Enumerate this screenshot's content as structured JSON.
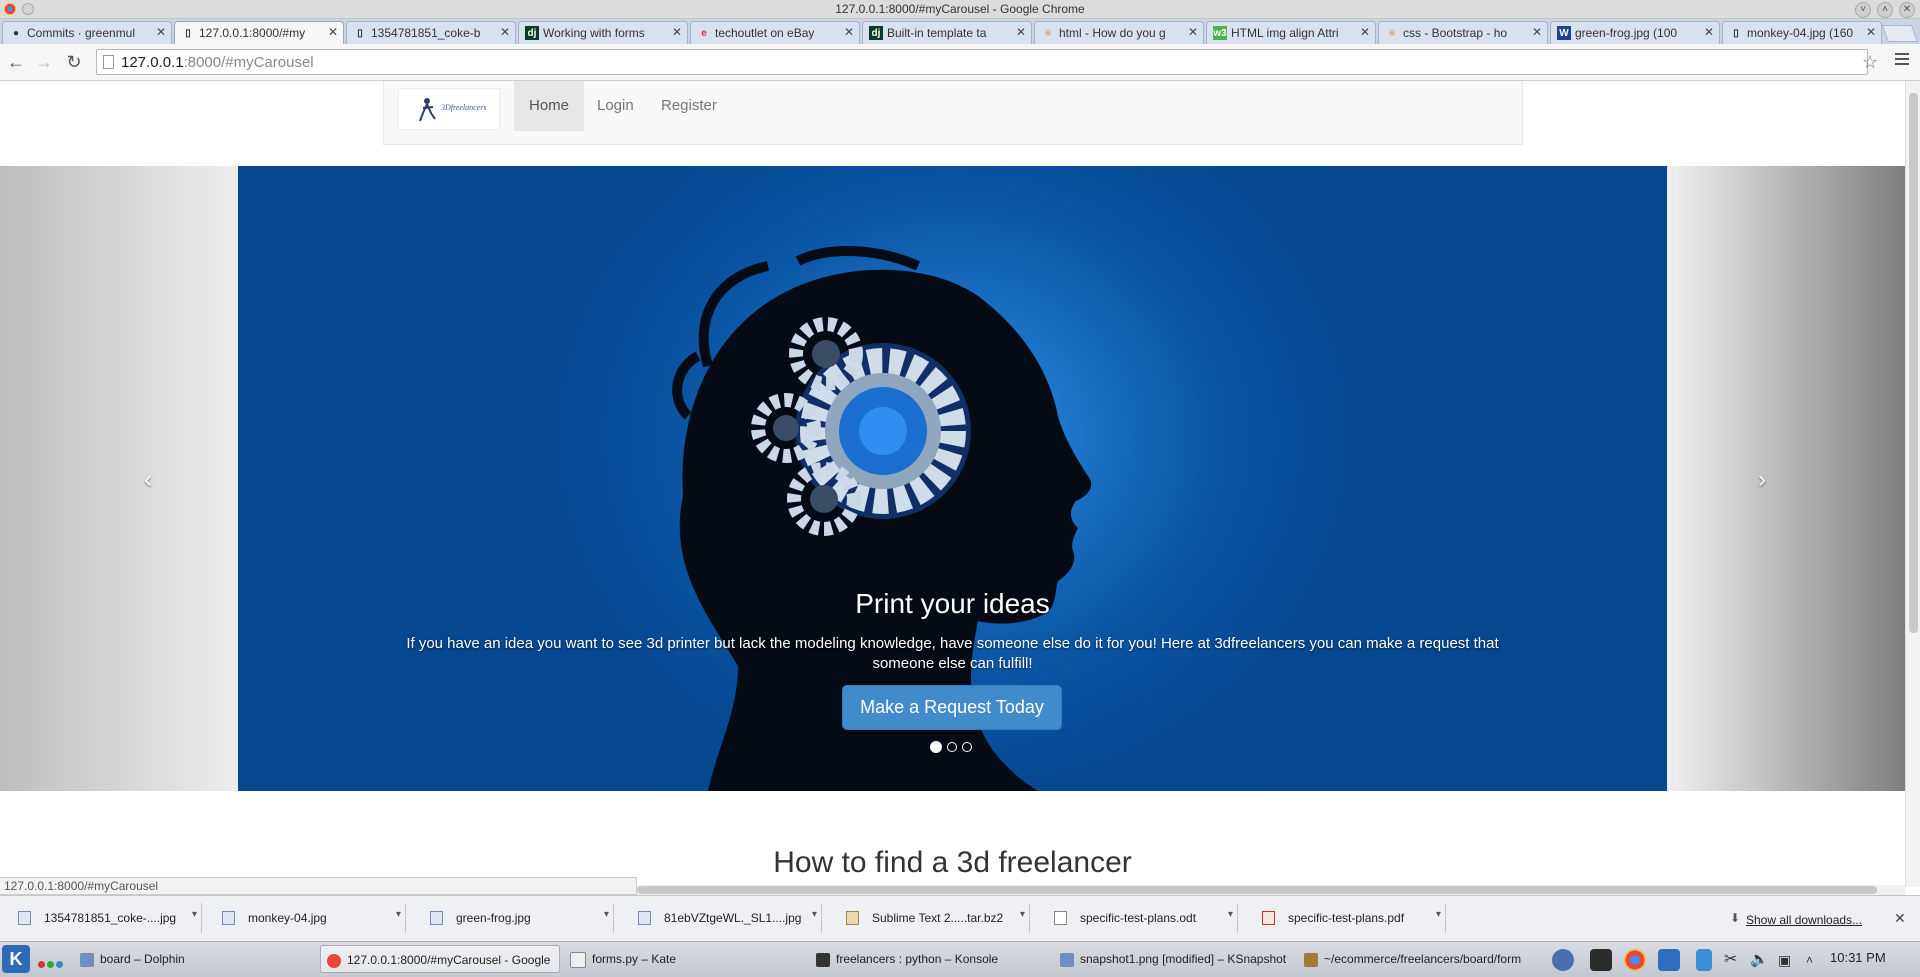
{
  "window": {
    "title": "127.0.0.1:8000/#myCarousel - Google Chrome"
  },
  "tabs": [
    {
      "label": "Commits · greenmul",
      "icon": "github-icon"
    },
    {
      "label": "127.0.0.1:8000/#my",
      "icon": "page-icon",
      "active": true
    },
    {
      "label": "1354781851_coke-b",
      "icon": "page-icon"
    },
    {
      "label": "Working with forms",
      "icon": "django-icon"
    },
    {
      "label": "techoutlet on eBay",
      "icon": "ebay-icon"
    },
    {
      "label": "Built-in template ta",
      "icon": "django-icon"
    },
    {
      "label": "html - How do you g",
      "icon": "stackoverflow-icon"
    },
    {
      "label": "HTML img align Attri",
      "icon": "w3schools-icon"
    },
    {
      "label": "css - Bootstrap - ho",
      "icon": "stackoverflow-icon"
    },
    {
      "label": "green-frog.jpg (100",
      "icon": "w-icon"
    },
    {
      "label": "monkey-04.jpg (160",
      "icon": "page-icon"
    }
  ],
  "toolbar": {
    "url_host": "127.0.0.1",
    "url_rest": ":8000/#myCarousel"
  },
  "site": {
    "brand": "3Dfreelancers",
    "nav": [
      "Home",
      "Login",
      "Register"
    ],
    "carousel": {
      "title": "Print your ideas",
      "text": "If you have an idea you want to see 3d printer but lack the modeling knowledge, have someone else do it for you! Here at 3dfreelancers you can make a request that someone else can fulfill!",
      "cta": "Make a Request Today",
      "prev": "‹",
      "next": "›",
      "active_slide": 1,
      "slide_count": 3
    },
    "section_heading": "How to find a 3d freelancer"
  },
  "status_url": "127.0.0.1:8000/#myCarousel",
  "downloads": [
    "1354781851_coke-....jpg",
    "monkey-04.jpg",
    "green-frog.jpg",
    "81ebVZtgeWL._SL1....jpg",
    "Sublime Text 2.....tar.bz2",
    "specific-test-plans.odt",
    "specific-test-plans.pdf"
  ],
  "downloads_show_all": "Show all downloads...",
  "taskbar": {
    "tasks": [
      "board – Dolphin",
      "127.0.0.1:8000/#myCarousel - Google",
      "forms.py – Kate",
      "freelancers : python – Konsole",
      "snapshot1.png [modified] – KSnapshot",
      "~/ecommerce/freelancers/board/form"
    ],
    "clock": "10:31 PM"
  },
  "colors": {
    "slide_blue": "#06478e",
    "cta_blue": "#428bca"
  }
}
